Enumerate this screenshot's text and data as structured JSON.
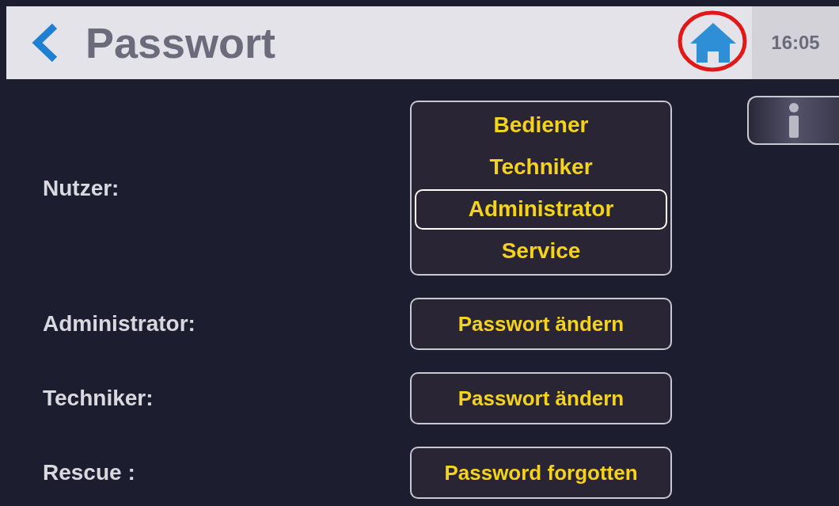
{
  "header": {
    "title": "Passwort",
    "time": "16:05"
  },
  "user_select": {
    "label": "Nutzer:",
    "options": [
      {
        "label": "Bediener",
        "selected": false
      },
      {
        "label": "Techniker",
        "selected": false
      },
      {
        "label": "Administrator",
        "selected": true
      },
      {
        "label": "Service",
        "selected": false
      }
    ]
  },
  "rows": [
    {
      "label": "Administrator:",
      "button": "Passwort ändern"
    },
    {
      "label": "Techniker:",
      "button": "Passwort ändern"
    },
    {
      "label": "Rescue :",
      "button": "Password forgotten"
    }
  ]
}
